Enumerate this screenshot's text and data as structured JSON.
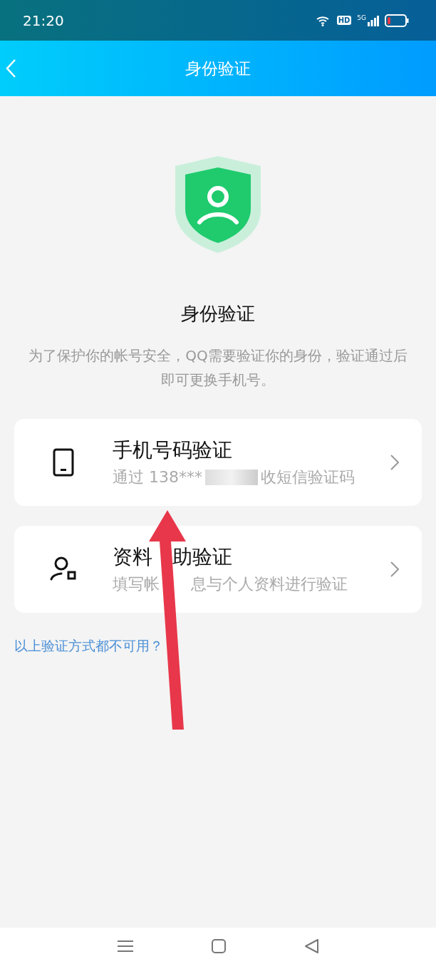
{
  "status_bar": {
    "time": "21:20",
    "hd": "HD",
    "network": "5G"
  },
  "nav": {
    "title": "身份验证"
  },
  "heading": "身份验证",
  "description": "为了保护你的帐号安全，QQ需要验证你的身份，验证通过后即可更换手机号。",
  "options": [
    {
      "kind": "phone",
      "title_parts": [
        "手机号码验证"
      ],
      "subtitle_parts": [
        "通过 138***",
        "收短信验证码"
      ],
      "redacted": true
    },
    {
      "kind": "profile",
      "title_parts": [
        "资料",
        "助验证"
      ],
      "subtitle_parts": [
        "填写帐",
        "息与个人资料进行验证"
      ],
      "redacted": false
    }
  ],
  "help_link": "以上验证方式都不可用？"
}
